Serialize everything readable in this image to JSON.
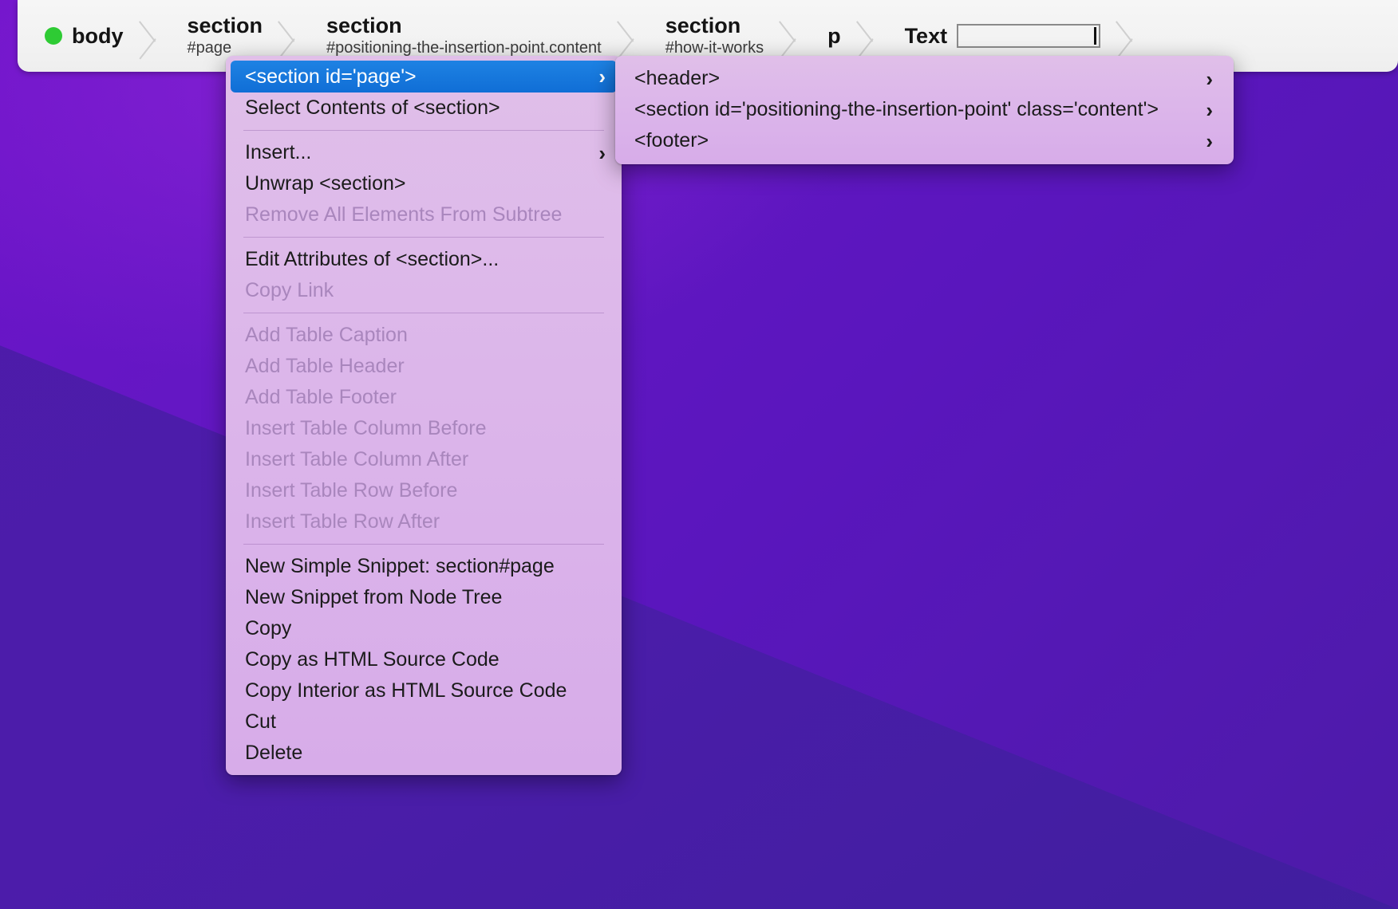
{
  "breadcrumb": {
    "items": [
      {
        "tag": "body",
        "sub": "",
        "dot": true
      },
      {
        "tag": "section",
        "sub": "#page",
        "dot": false
      },
      {
        "tag": "section",
        "sub": "#positioning-the-insertion-point.content",
        "dot": false
      },
      {
        "tag": "section",
        "sub": "#how-it-works",
        "dot": false
      },
      {
        "tag": "p",
        "sub": "",
        "dot": false
      },
      {
        "tag": "Text",
        "sub": "",
        "dot": false
      }
    ],
    "text_field_value": ""
  },
  "context_menu": {
    "items": [
      {
        "label": "<section id='page'>",
        "state": "selected",
        "submenu": true
      },
      {
        "label": "Select Contents of <section>",
        "state": "enabled",
        "submenu": false
      },
      {
        "label": "",
        "state": "separator",
        "submenu": false
      },
      {
        "label": "Insert...",
        "state": "enabled",
        "submenu": true
      },
      {
        "label": "Unwrap <section>",
        "state": "enabled",
        "submenu": false
      },
      {
        "label": "Remove All Elements From Subtree",
        "state": "disabled",
        "submenu": false
      },
      {
        "label": "",
        "state": "separator",
        "submenu": false
      },
      {
        "label": "Edit Attributes of <section>...",
        "state": "enabled",
        "submenu": false
      },
      {
        "label": "Copy Link",
        "state": "disabled",
        "submenu": false
      },
      {
        "label": "",
        "state": "separator",
        "submenu": false
      },
      {
        "label": "Add Table Caption",
        "state": "disabled",
        "submenu": false
      },
      {
        "label": "Add Table Header",
        "state": "disabled",
        "submenu": false
      },
      {
        "label": "Add Table Footer",
        "state": "disabled",
        "submenu": false
      },
      {
        "label": "Insert Table Column Before",
        "state": "disabled",
        "submenu": false
      },
      {
        "label": "Insert Table Column After",
        "state": "disabled",
        "submenu": false
      },
      {
        "label": "Insert Table Row Before",
        "state": "disabled",
        "submenu": false
      },
      {
        "label": "Insert Table Row After",
        "state": "disabled",
        "submenu": false
      },
      {
        "label": "",
        "state": "separator",
        "submenu": false
      },
      {
        "label": "New Simple Snippet: section#page",
        "state": "enabled",
        "submenu": false
      },
      {
        "label": "New Snippet from Node Tree",
        "state": "enabled",
        "submenu": false
      },
      {
        "label": "Copy",
        "state": "enabled",
        "submenu": false
      },
      {
        "label": "Copy as HTML Source Code",
        "state": "enabled",
        "submenu": false
      },
      {
        "label": "Copy Interior as HTML Source Code",
        "state": "enabled",
        "submenu": false
      },
      {
        "label": "Cut",
        "state": "enabled",
        "submenu": false
      },
      {
        "label": "Delete",
        "state": "enabled",
        "submenu": false
      }
    ]
  },
  "submenu": {
    "items": [
      {
        "label": "<header>",
        "submenu": true
      },
      {
        "label": "<section id='positioning-the-insertion-point' class='content'>",
        "submenu": true
      },
      {
        "label": "<footer>",
        "submenu": true
      }
    ]
  },
  "icons": {
    "chevron_right": "›",
    "status_dot": "status-dot"
  },
  "colors": {
    "menu_background": "#dcb6ea",
    "selection_blue": "#1277db",
    "status_green": "#2ecb34",
    "desktop_purple": "#6417c4",
    "disabled_text": "#a986bd"
  }
}
